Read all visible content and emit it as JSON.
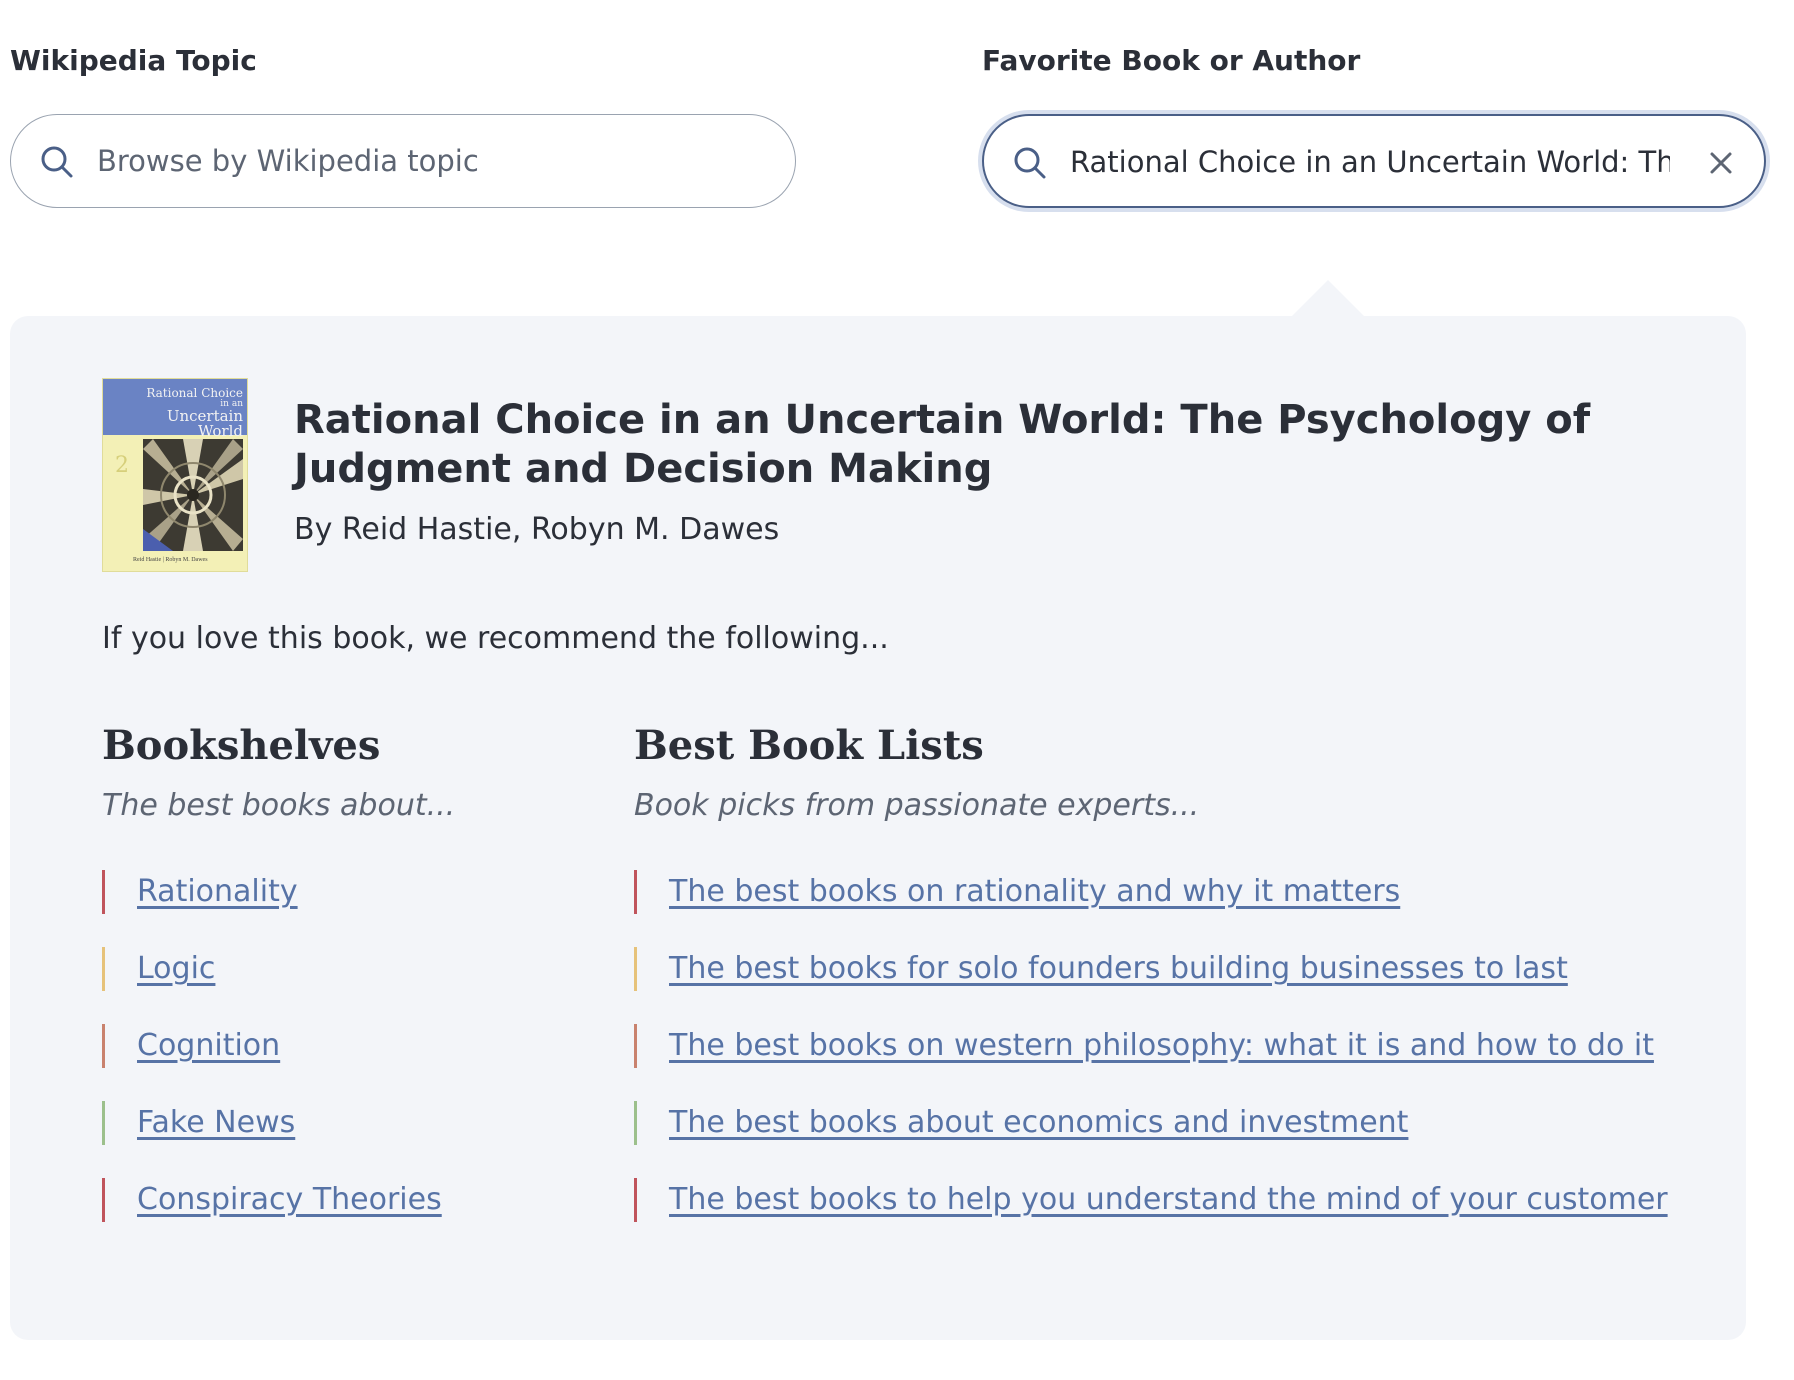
{
  "wikipedia_search": {
    "label": "Wikipedia Topic",
    "placeholder": "Browse by Wikipedia topic",
    "value": ""
  },
  "book_search": {
    "label": "Favorite Book or Author",
    "placeholder": "",
    "value": "Rational Choice in an Uncertain World: The Psy"
  },
  "book": {
    "title": "Rational Choice in an Uncertain World: The Psychology of Judgment and Decision Making",
    "author": "By Reid Hastie, Robyn M. Dawes",
    "cover": {
      "title_line1": "Rational Choice",
      "title_line2": "in an",
      "title_line3": "Uncertain",
      "title_line4": "World",
      "edition": "2",
      "authors": "Reid Hastie | Robyn M. Dawes"
    }
  },
  "recommend_text": "If you love this book, we recommend the following...",
  "bookshelves": {
    "heading": "Bookshelves",
    "subheading": "The best books about...",
    "items": [
      {
        "label": "Rationality",
        "color": "#c0545c"
      },
      {
        "label": "Logic",
        "color": "#e6c27a"
      },
      {
        "label": "Cognition",
        "color": "#c9826e"
      },
      {
        "label": "Fake News",
        "color": "#9cc08c"
      },
      {
        "label": "Conspiracy Theories",
        "color": "#c0545c"
      }
    ]
  },
  "best_book_lists": {
    "heading": "Best Book Lists",
    "subheading": "Book picks from passionate experts...",
    "items": [
      {
        "label": "The best books on rationality and why it matters",
        "color": "#c0545c"
      },
      {
        "label": "The best books for solo founders building businesses to last",
        "color": "#e6c27a"
      },
      {
        "label": "The best books on western philosophy: what it is and how to do it",
        "color": "#c9826e"
      },
      {
        "label": "The best books about economics and investment",
        "color": "#9cc08c"
      },
      {
        "label": "The best books to help you understand the mind of your customer",
        "color": "#c0545c"
      }
    ]
  },
  "colors": {
    "link": "#5773a6",
    "panel_bg": "#f3f5f9",
    "focus_border": "#4a5f87"
  },
  "icons": {
    "search": "search-icon",
    "clear": "close-icon"
  }
}
